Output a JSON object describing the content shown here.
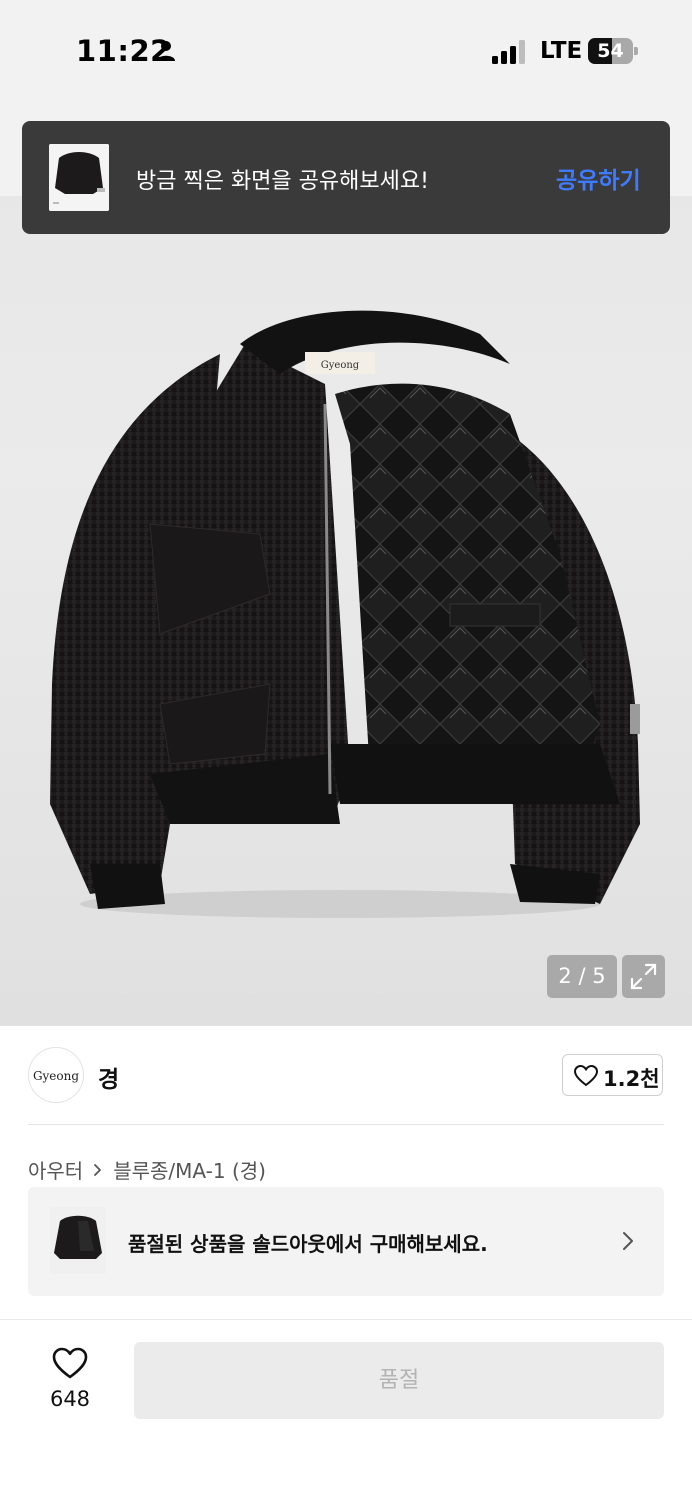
{
  "status_bar": {
    "time": "11:22",
    "network": "LTE",
    "battery": "54",
    "battery_level": 0.54
  },
  "share_toast": {
    "message": "방금 찍은 화면을 공유해보세요!",
    "action_label": "공유하기",
    "action_color": "#3f7bff"
  },
  "gallery": {
    "counter": "2 / 5",
    "current": 2,
    "total": 5,
    "label_on_garment": "Gyeong"
  },
  "brand": {
    "logo_text": "Gyeong",
    "name": "경",
    "likes": "1.2천"
  },
  "breadcrumb": {
    "items": [
      "아우터",
      "블루종/MA-1 (경)"
    ]
  },
  "soldout_card": {
    "text": "품절된 상품을 솔드아웃에서 구매해보세요."
  },
  "bottom_bar": {
    "wish_count": "648",
    "buy_button_label": "품절"
  }
}
